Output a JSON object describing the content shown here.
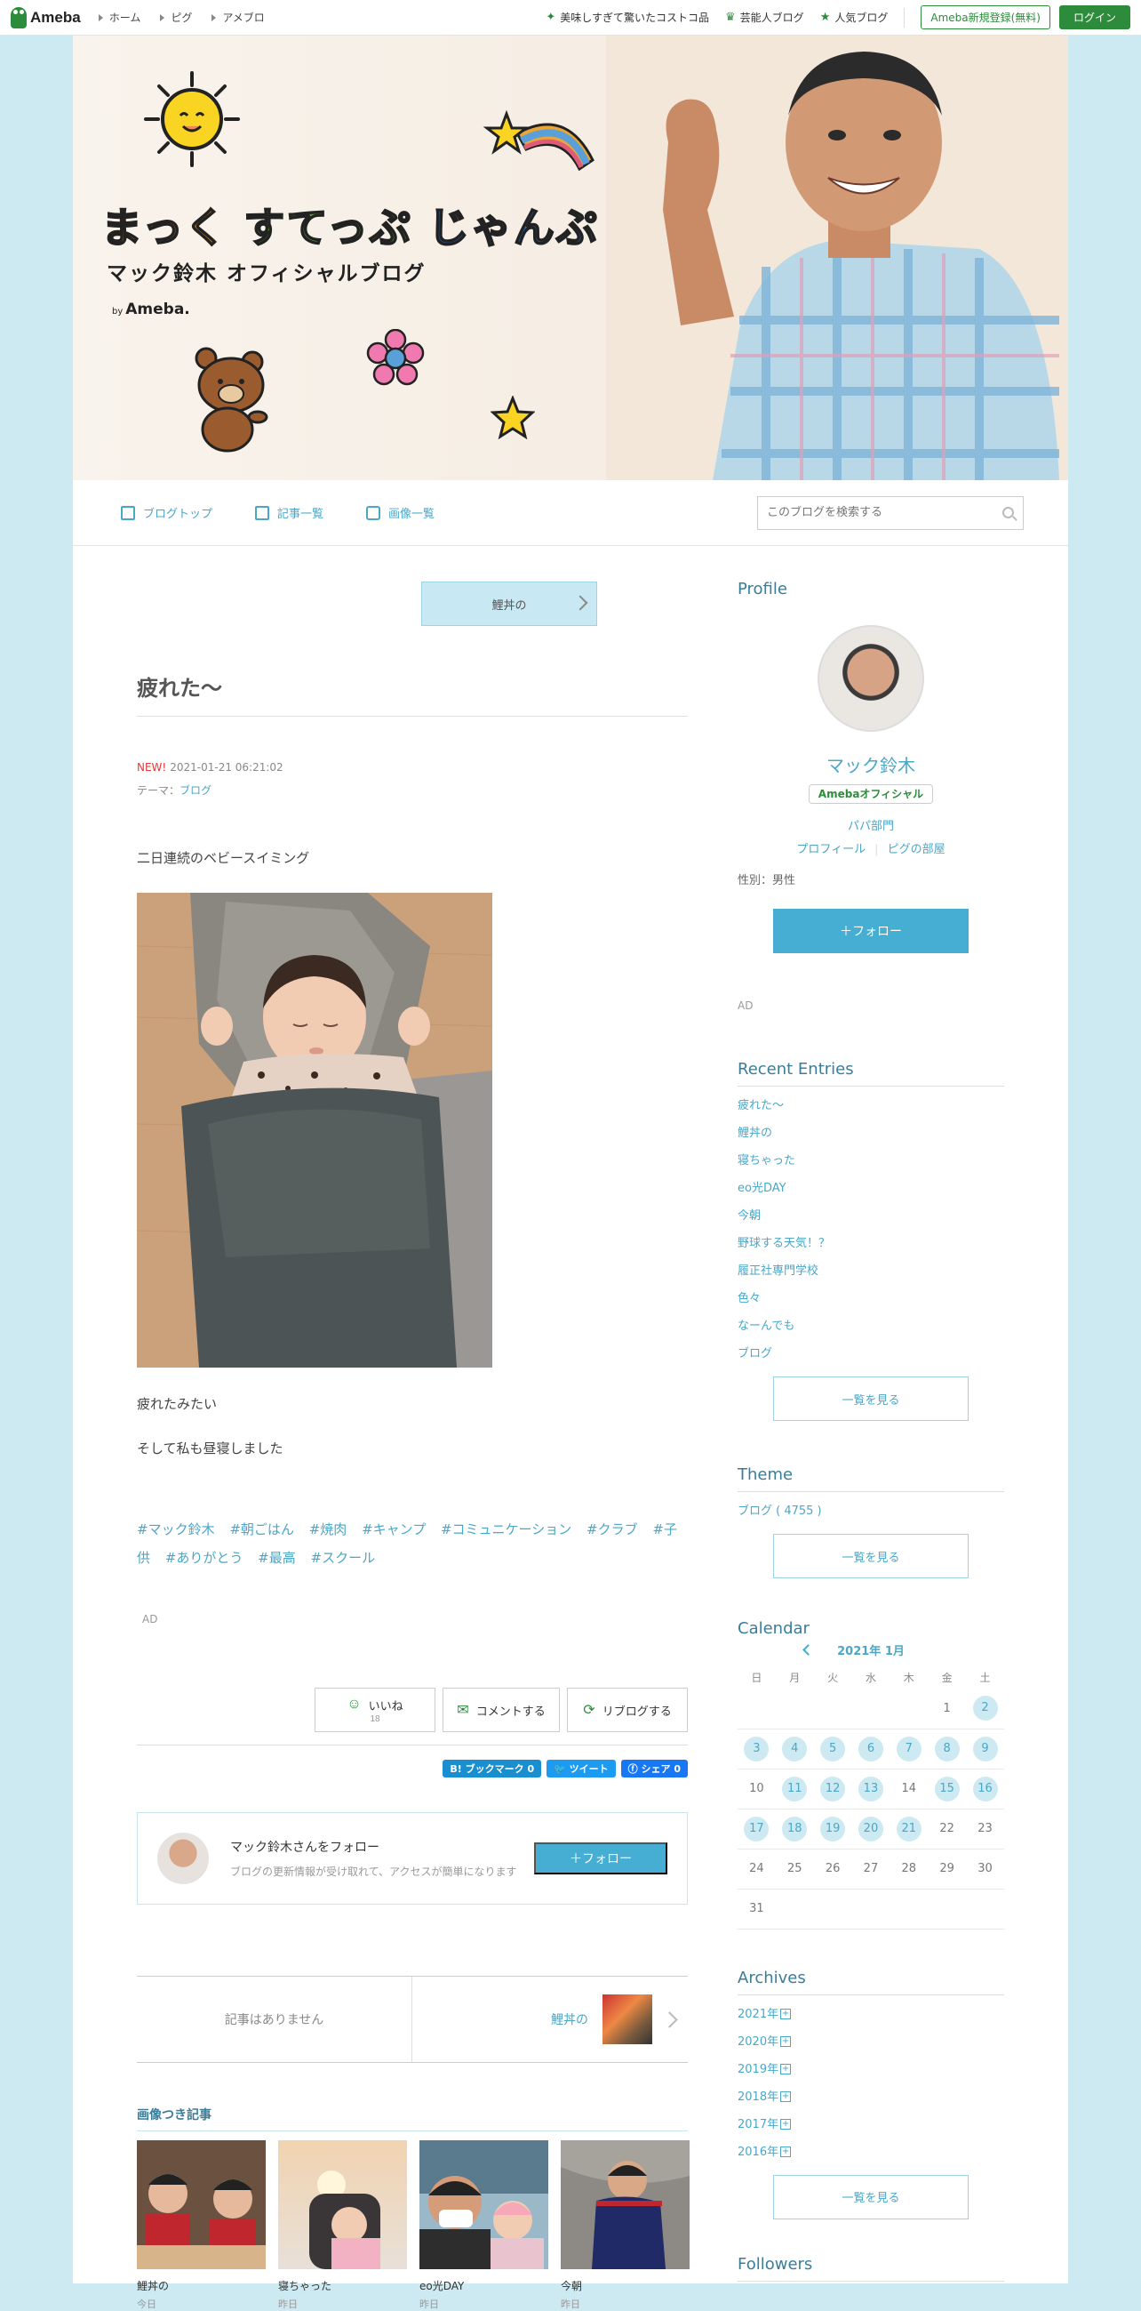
{
  "topbar": {
    "logo": "Ameba",
    "nav": [
      "ホーム",
      "ピグ",
      "アメブロ"
    ],
    "picks": [
      "美味しすぎて驚いたコストコ品",
      "芸能人ブログ",
      "人気ブログ"
    ],
    "register": "Ameba新規登録(無料)",
    "login": "ログイン"
  },
  "banner": {
    "title_a": "まっく",
    "title_b": "すてっぷ",
    "title_c": "じゃんぷ",
    "subtitle": "マック鈴木 オフィシャルブログ",
    "by": "by",
    "brand": "Ameba."
  },
  "blognav": {
    "top": "ブログトップ",
    "list": "記事一覧",
    "images": "画像一覧",
    "search_placeholder": "このブログを検索する"
  },
  "entry": {
    "prev_label": "鯉丼の",
    "title": "疲れた〜",
    "new_badge": "NEW!",
    "datetime": "2021-01-21 06:21:02",
    "theme_label": "テーマ：",
    "theme": "ブログ",
    "para1": "二日連続のベビースイミング",
    "para2": "疲れたみたい",
    "para3": "そして私も昼寝しました",
    "hashtags": [
      "#マック鈴木",
      "#朝ごはん",
      "#焼肉",
      "#キャンプ",
      "#コミュニケーション",
      "#クラブ",
      "#子供",
      "#ありがとう",
      "#最高",
      "#スクール"
    ],
    "ad": "AD"
  },
  "reactions": {
    "like": "いいね",
    "like_count": "18",
    "comment": "コメントする",
    "reblog": "リブログする"
  },
  "share": {
    "hatena": "B! ブックマーク  0",
    "tweet": "ツイート",
    "facebook": "シェア  0"
  },
  "followbox": {
    "title": "マック鈴木さんをフォロー",
    "desc": "ブログの更新情報が受け取れて、アクセスが簡単になります",
    "button": "＋フォロー"
  },
  "pager": {
    "prev": "記事はありません",
    "next": "鯉丼の"
  },
  "image_entries": {
    "heading": "画像つき記事",
    "items": [
      {
        "title": "鯉丼の",
        "date": "今日"
      },
      {
        "title": "寝ちゃった",
        "date": "昨日"
      },
      {
        "title": "eo光DAY",
        "date": "昨日"
      },
      {
        "title": "今朝",
        "date": "昨日"
      }
    ]
  },
  "sidebar": {
    "profile_heading": "Profile",
    "name": "マック鈴木",
    "official": "Amebaオフィシャル",
    "category": "パパ部門",
    "link_profile": "プロフィール",
    "link_room": "ピグの部屋",
    "sex": "性別：男性",
    "follow": "＋フォロー",
    "ad": "AD",
    "recent_heading": "Recent Entries",
    "recent": [
      "疲れた〜",
      "鯉丼の",
      "寝ちゃった",
      "eo光DAY",
      "今朝",
      "野球する天気！？",
      "履正社専門学校",
      "色々",
      "なーんでも",
      "ブログ"
    ],
    "see_all": "一覧を見る",
    "theme_heading": "Theme",
    "theme_item": "ブログ ( 4755 )",
    "calendar_heading": "Calendar",
    "calendar_month": "2021年 1月",
    "weekdays": [
      "日",
      "月",
      "火",
      "水",
      "木",
      "金",
      "土"
    ],
    "archives_heading": "Archives",
    "archives": [
      "2021年",
      "2020年",
      "2019年",
      "2018年",
      "2017年",
      "2016年"
    ],
    "followers_heading": "Followers"
  }
}
